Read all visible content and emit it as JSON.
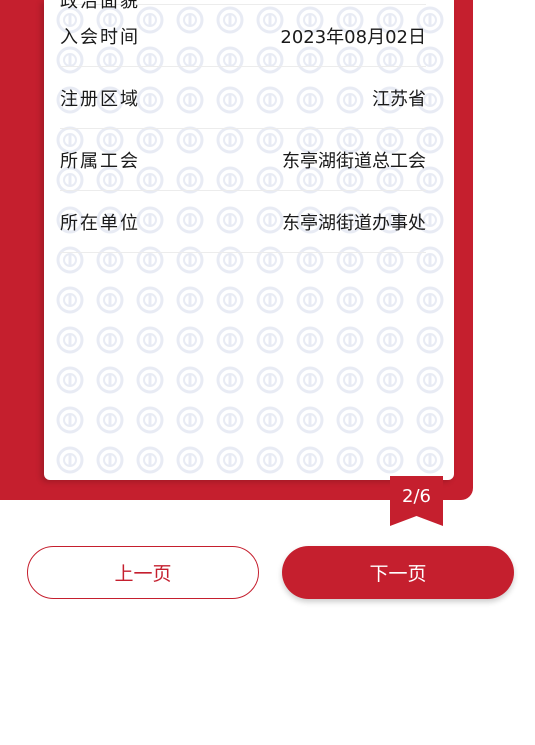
{
  "card": {
    "rows": [
      {
        "label": "政治面貌",
        "value": ""
      },
      {
        "label": "入会时间",
        "value": "2023年08月02日"
      },
      {
        "label": "注册区域",
        "value": "江苏省"
      },
      {
        "label": "所属工会",
        "value": "东亭湖街道总工会"
      },
      {
        "label": "所在单位",
        "value": "东亭湖街道办事处"
      }
    ]
  },
  "pager": {
    "indicator": "2/6"
  },
  "buttons": {
    "prev_label": "上一页",
    "next_label": "下一页"
  },
  "colors": {
    "accent": "#c51f2e",
    "pattern": "#eef0f7"
  },
  "icons": {
    "watermark": "union-emblem-icon"
  }
}
